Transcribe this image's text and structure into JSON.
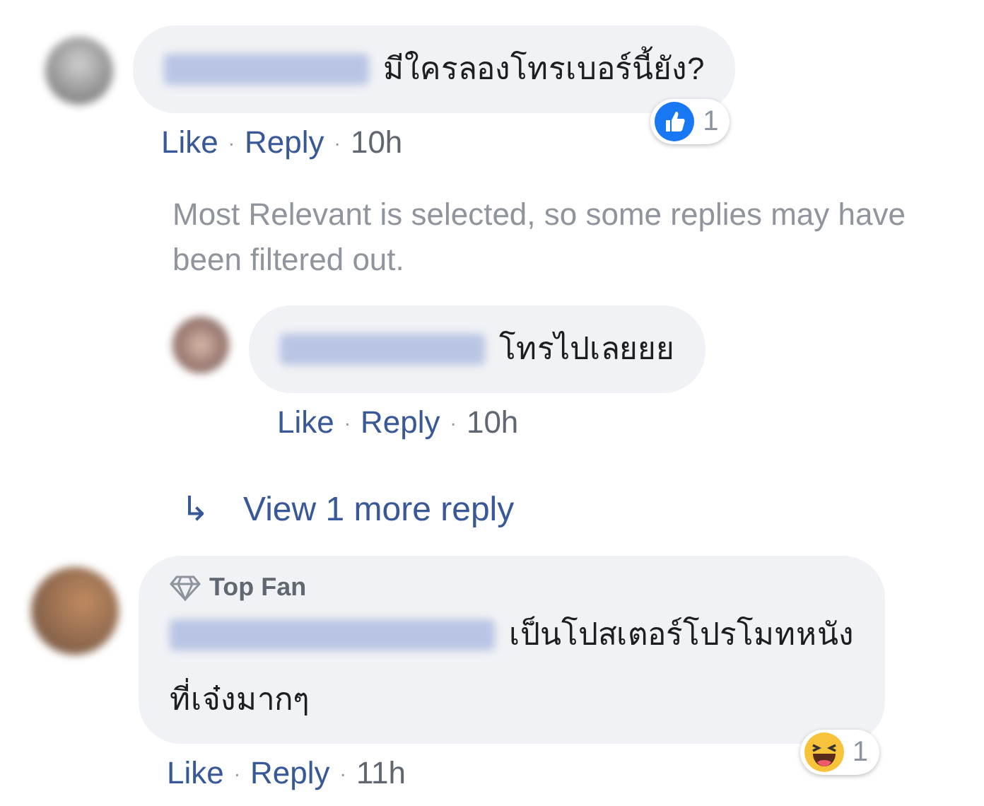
{
  "comments": [
    {
      "text_lines": [
        "มีใครลองโทรเบอร์นี้ยัง?"
      ],
      "reaction": {
        "kind": "like",
        "count": "1"
      },
      "actions": [
        "Like",
        "Reply"
      ],
      "separator": "·",
      "time": "10h",
      "notice": "Most Relevant is selected, so some replies may have been filtered out.",
      "replies": [
        {
          "text_lines": [
            "โทรไปเลยยย"
          ],
          "actions": [
            "Like",
            "Reply"
          ],
          "separator": "·",
          "time": "10h"
        }
      ],
      "view_more": {
        "icon": "↳",
        "label": "View 1 more reply"
      }
    },
    {
      "badge": "Top Fan",
      "text_lines": [
        "เป็นโปสเตอร์โปรโมทหนัง",
        "ที่เจ๋งมากๆ"
      ],
      "reaction": {
        "kind": "haha",
        "count": "1"
      },
      "actions": [
        "Like",
        "Reply"
      ],
      "separator": "·",
      "time": "11h"
    }
  ]
}
